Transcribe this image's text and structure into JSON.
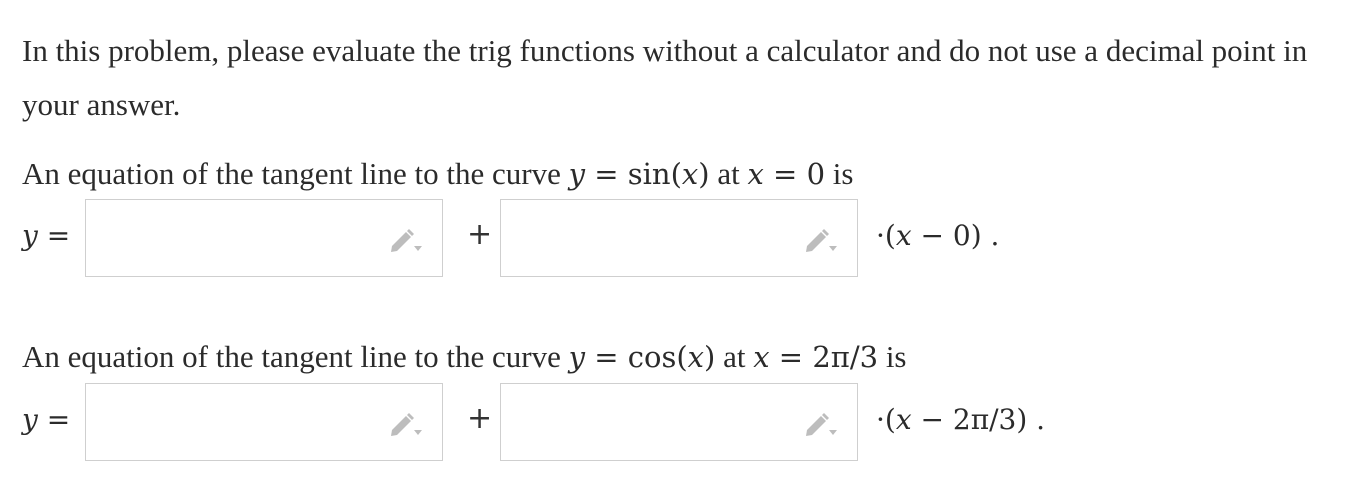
{
  "intro": "In this problem, please evaluate the trig functions without a calculator and do not use a decimal point in your answer.",
  "problems": [
    {
      "prefix": "An equation of the tangent line to the curve ",
      "curve_var": "y",
      "curve_eq": " = sin(",
      "curve_arg": "x",
      "curve_close": ")",
      "at_text": " at ",
      "point_var": "x",
      "point_eq": " = 0",
      "suffix": " is",
      "answer_lhs_var": "y",
      "answer_lhs_eq": " =",
      "plus": "+",
      "tail_open": "·(",
      "tail_var": "x",
      "tail_rest": " − 0) .",
      "input1_value": "",
      "input2_value": ""
    },
    {
      "prefix": "An equation of the tangent line to the curve ",
      "curve_var": "y",
      "curve_eq": " = cos(",
      "curve_arg": "x",
      "curve_close": ")",
      "at_text": " at ",
      "point_var": "x",
      "point_eq": " = 2π/3",
      "suffix": " is",
      "answer_lhs_var": "y",
      "answer_lhs_eq": " =",
      "plus": "+",
      "tail_open": "·(",
      "tail_var": "x",
      "tail_rest": " − 2π/3) .",
      "input1_value": "",
      "input2_value": ""
    }
  ],
  "icons": {
    "edit": "pencil-icon"
  },
  "colors": {
    "text": "#2b2b2b",
    "border": "#cfcfcf",
    "icon": "#bdbdbd"
  }
}
